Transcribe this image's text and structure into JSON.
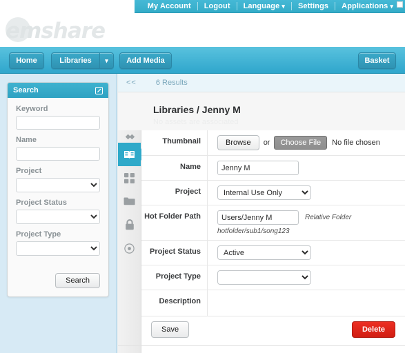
{
  "topnav": {
    "items": [
      {
        "label": "My Account",
        "caret": false
      },
      {
        "label": "Logout",
        "caret": false
      },
      {
        "label": "Language",
        "caret": true
      },
      {
        "label": "Settings",
        "caret": false
      },
      {
        "label": "Applications",
        "caret": true
      }
    ],
    "caret_glyph": "▾"
  },
  "brand": {
    "logo_em": "em",
    "logo_share": "share"
  },
  "nav": {
    "home": "Home",
    "libraries": "Libraries",
    "libraries_caret": "▾",
    "add_media": "Add Media",
    "basket": "Basket"
  },
  "sidebar": {
    "panel_title": "Search",
    "fields": [
      {
        "label": "Keyword",
        "type": "text",
        "value": ""
      },
      {
        "label": "Name",
        "type": "text",
        "value": ""
      },
      {
        "label": "Project",
        "type": "select",
        "value": ""
      },
      {
        "label": "Project Status",
        "type": "select",
        "value": ""
      },
      {
        "label": "Project Type",
        "type": "select",
        "value": ""
      }
    ],
    "search_button": "Search"
  },
  "results": {
    "back": "<<",
    "count": "6 Results"
  },
  "page": {
    "title": "Libraries / Jenny M",
    "subtitle": "No assets are associated"
  },
  "rail": {
    "items": [
      {
        "name": "book-icon",
        "active": true
      },
      {
        "name": "grid-icon",
        "active": false
      },
      {
        "name": "folder-icon",
        "active": false
      },
      {
        "name": "lock-icon",
        "active": false
      },
      {
        "name": "target-icon",
        "active": false
      }
    ]
  },
  "form": {
    "thumbnail": {
      "label": "Thumbnail",
      "browse": "Browse",
      "or": "or",
      "choose_file": "Choose File",
      "no_file": "No file chosen"
    },
    "name": {
      "label": "Name",
      "value": "Jenny M"
    },
    "project": {
      "label": "Project",
      "value": "Internal Use Only"
    },
    "hot_folder": {
      "label": "Hot Folder Path",
      "value": "Users/Jenny M",
      "note": "Relative Folder",
      "hint": "hotfolder/sub1/song123"
    },
    "project_status": {
      "label": "Project Status",
      "value": "Active"
    },
    "project_type": {
      "label": "Project Type",
      "value": ""
    },
    "description": {
      "label": "Description",
      "value": ""
    },
    "save": "Save",
    "delete": "Delete"
  },
  "colors": {
    "teal": "#2fa9c9",
    "nav_blue": "#59c2de",
    "sidebar_blue": "#d7eaf5",
    "delete_red": "#ec2f23"
  }
}
